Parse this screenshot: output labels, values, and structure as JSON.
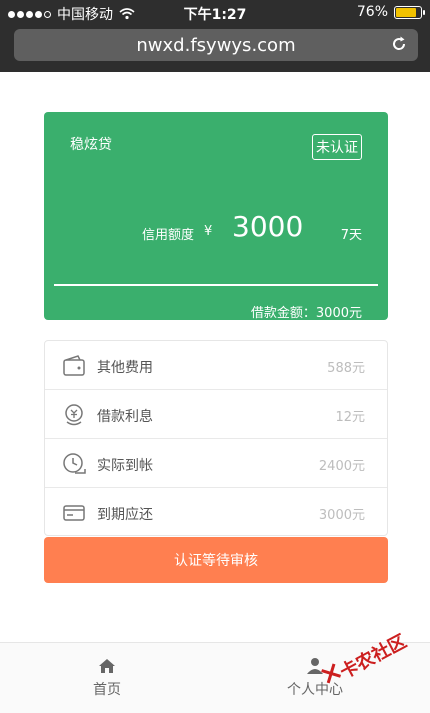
{
  "status_bar": {
    "carrier": "中国移动",
    "time": "下午1:27",
    "battery": "76%"
  },
  "browser": {
    "url": "nwxd.fsywys.com"
  },
  "card": {
    "brand": "稳炫贷",
    "badge": "未认证",
    "credit_label": "信用额度",
    "currency": "¥",
    "credit_value": "3000",
    "days": "7天",
    "loan_amount": "借款金额：3000元"
  },
  "details": [
    {
      "label": "其他费用",
      "value": "588元",
      "icon": "wallet-icon"
    },
    {
      "label": "借款利息",
      "value": "12元",
      "icon": "coin-icon"
    },
    {
      "label": "实际到帐",
      "value": "2400元",
      "icon": "clock-icon"
    },
    {
      "label": "到期应还",
      "value": "3000元",
      "icon": "card-icon"
    }
  ],
  "action": {
    "label": "认证等待审核"
  },
  "tabbar": {
    "home": "首页",
    "me": "个人中心"
  },
  "watermark": {
    "text": "卡农社区"
  },
  "colors": {
    "card_green": "#3aaf6d",
    "action_orange": "#ff7f50"
  }
}
